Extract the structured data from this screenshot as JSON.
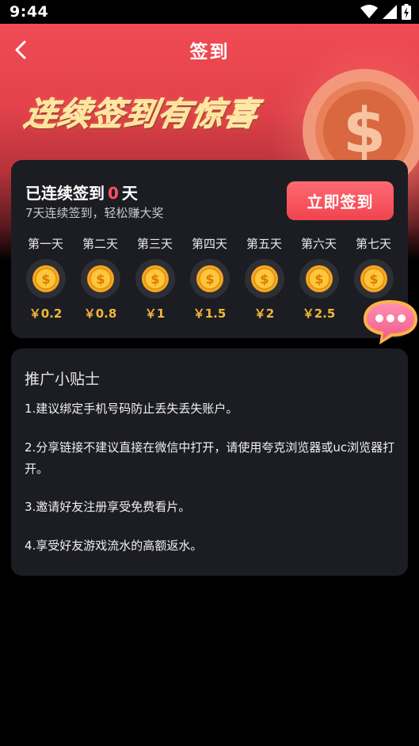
{
  "status_bar": {
    "time": "9:44"
  },
  "nav": {
    "title": "签到"
  },
  "banner": {
    "text": "连续签到有惊喜"
  },
  "signin": {
    "prefix": "已连续签到",
    "days": "0",
    "suffix": "天",
    "subtitle": "7天连续签到，轻松赚大奖",
    "button_label": "立即签到"
  },
  "days": [
    {
      "label": "第一天",
      "amount": "￥0.2"
    },
    {
      "label": "第二天",
      "amount": "￥0.8"
    },
    {
      "label": "第三天",
      "amount": "￥1"
    },
    {
      "label": "第四天",
      "amount": "￥1.5"
    },
    {
      "label": "第五天",
      "amount": "￥2"
    },
    {
      "label": "第六天",
      "amount": "￥2.5"
    },
    {
      "label": "第七天",
      "amount": "￥"
    }
  ],
  "tips": {
    "title": "推广小贴士",
    "items": [
      "1.建议绑定手机号码防止丢失丢失账户。",
      "2.分享链接不建议直接在微信中打开，请使用夸克浏览器或uc浏览器打开。",
      "3.邀请好友注册享受免费看片。",
      "4.享受好友游戏流水的高额返水。"
    ]
  },
  "colors": {
    "accent_red": "#f0444f",
    "gold": "#f2b63a",
    "card_bg": "#1c1d22"
  }
}
